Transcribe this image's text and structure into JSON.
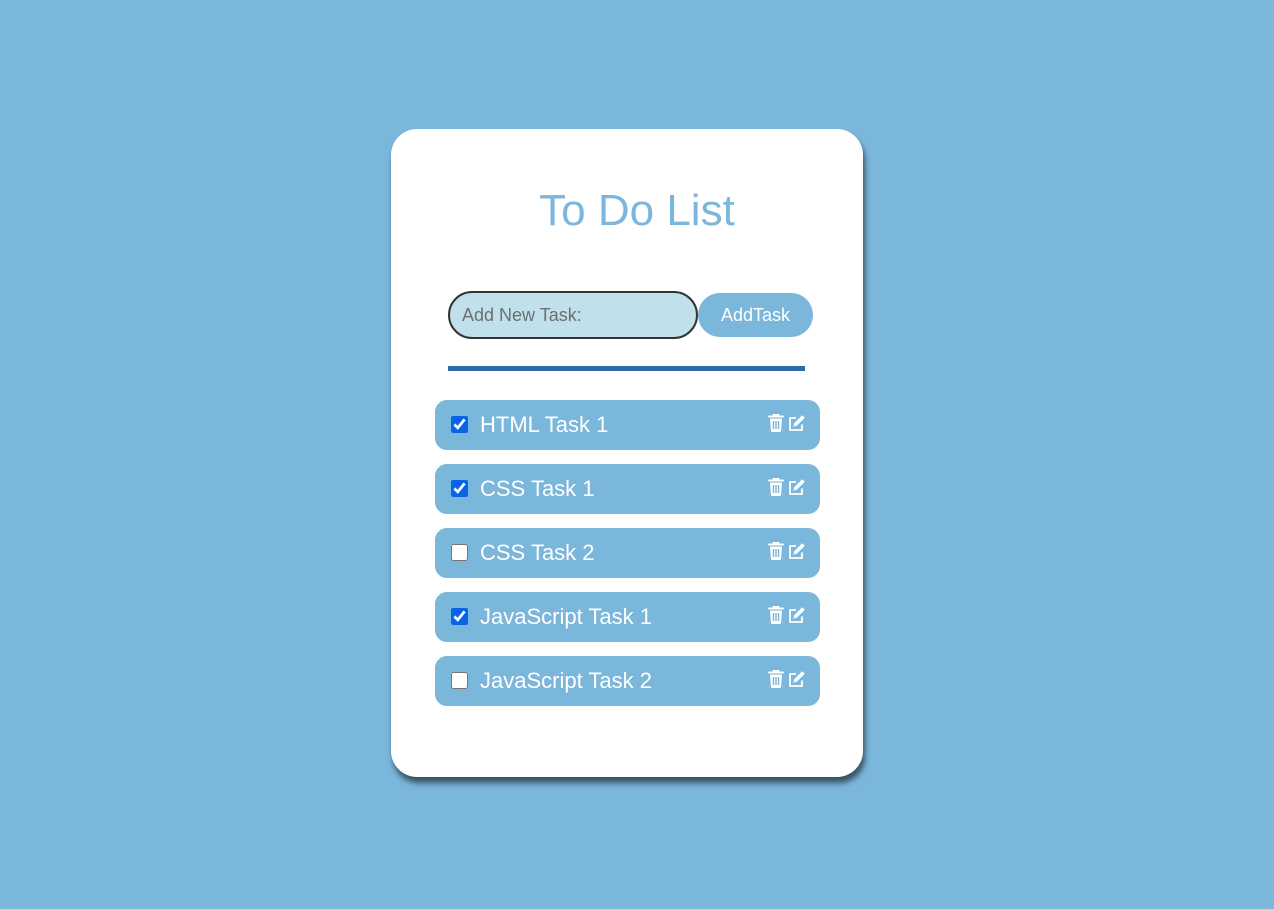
{
  "app": {
    "title": "To Do List"
  },
  "add_form": {
    "input_placeholder": "Add New Task:",
    "input_value": "",
    "button_label": "AddTask"
  },
  "tasks": [
    {
      "label": "HTML Task 1",
      "checked": true
    },
    {
      "label": "CSS Task 1",
      "checked": true
    },
    {
      "label": "CSS Task 2",
      "checked": false
    },
    {
      "label": "JavaScript Task 1",
      "checked": true
    },
    {
      "label": "JavaScript Task 2",
      "checked": false
    }
  ],
  "task_icons": [
    "trash-icon",
    "edit-icon"
  ],
  "colors": {
    "background": "#7bb6db",
    "card": "#ffffff",
    "accent": "#7bb6db",
    "input_bg": "#c0e0eb",
    "divider": "#2e6aa6",
    "checkbox": "#0a64e6"
  }
}
